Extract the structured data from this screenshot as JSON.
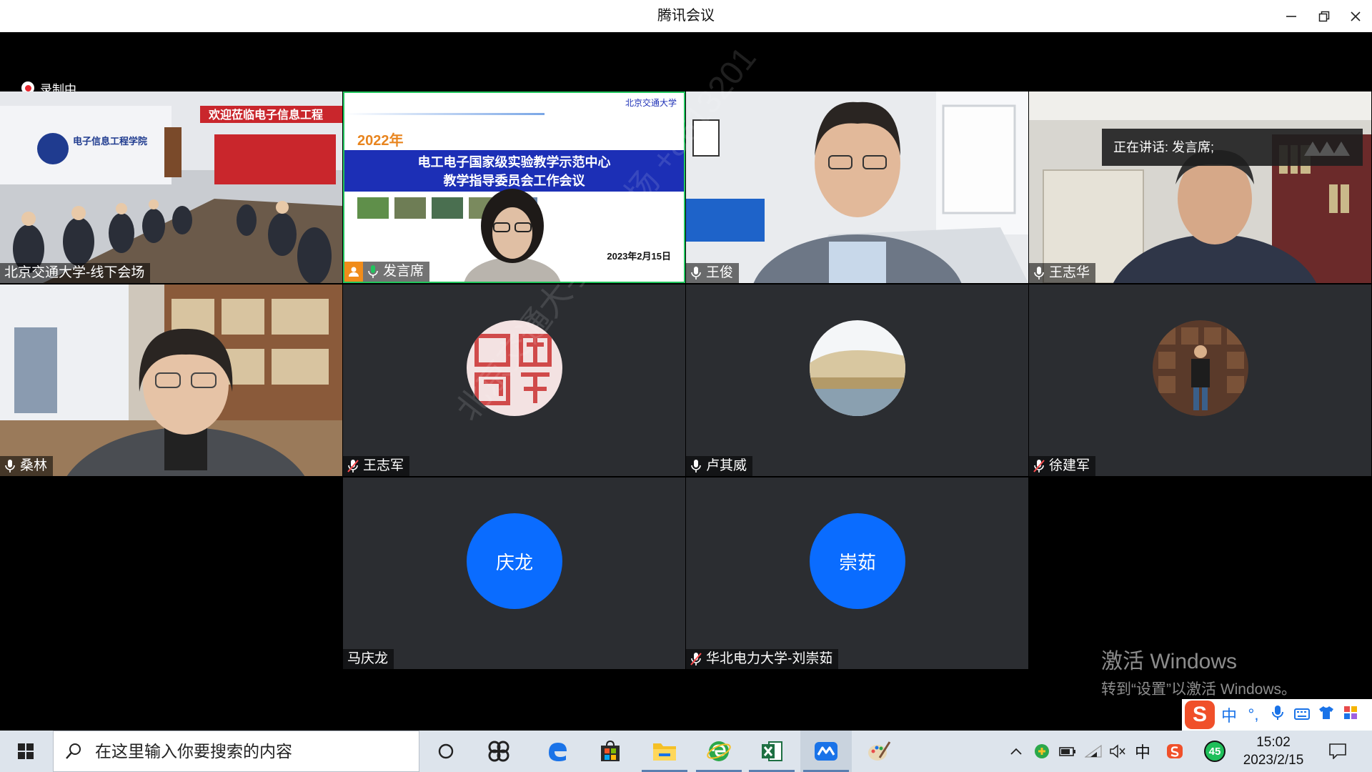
{
  "app": {
    "title": "腾讯会议"
  },
  "recording": {
    "label": "录制中"
  },
  "speaking": {
    "label": "正在讲话: 发言席;"
  },
  "participants": [
    {
      "name": "北京交通大学-线下会场",
      "mic": "none"
    },
    {
      "name": "发言席",
      "mic": "active"
    },
    {
      "name": "王俊",
      "mic": "on"
    },
    {
      "name": "王志华",
      "mic": "on"
    },
    {
      "name": "桑林",
      "mic": "on"
    },
    {
      "name": "王志军",
      "mic": "muted"
    },
    {
      "name": "卢其威",
      "mic": "on"
    },
    {
      "name": "徐建军",
      "mic": "muted"
    },
    {
      "name": "马庆龙",
      "mic": "none",
      "avatar_text": "庆龙"
    },
    {
      "name": "华北电力大学-刘崇茹",
      "mic": "muted",
      "avatar_text": "崇茹"
    }
  ],
  "slide": {
    "year": "2022年",
    "line1": "电工电子国家级实验教学示范中心",
    "line2": "教学指导委员会工作会议",
    "date": "2023年2月15日",
    "logo": "北京交通大学"
  },
  "room_sign": {
    "banner": "欢迎莅临电子信息工程",
    "school": "电子信息工程学院"
  },
  "watermark": "北京交通大学-主会场 +8613201",
  "activate": {
    "title": "激活 Windows",
    "subtitle": "转到“设置”以激活 Windows。"
  },
  "ime": {
    "items": [
      "中",
      "°,",
      "mic-icon",
      "keyboard-icon",
      "skin-icon",
      "tools-icon"
    ],
    "lang": "中"
  },
  "taskbar": {
    "search_placeholder": "在这里输入你要搜索的内容",
    "tray_lang": "中",
    "badge": "45",
    "time": "15:02",
    "date": "2023/2/15"
  },
  "colors": {
    "accent": "#0a6cff",
    "tile_bg": "#2b2d31",
    "active_border": "#22c55e",
    "muted": "#ff4d4f"
  }
}
